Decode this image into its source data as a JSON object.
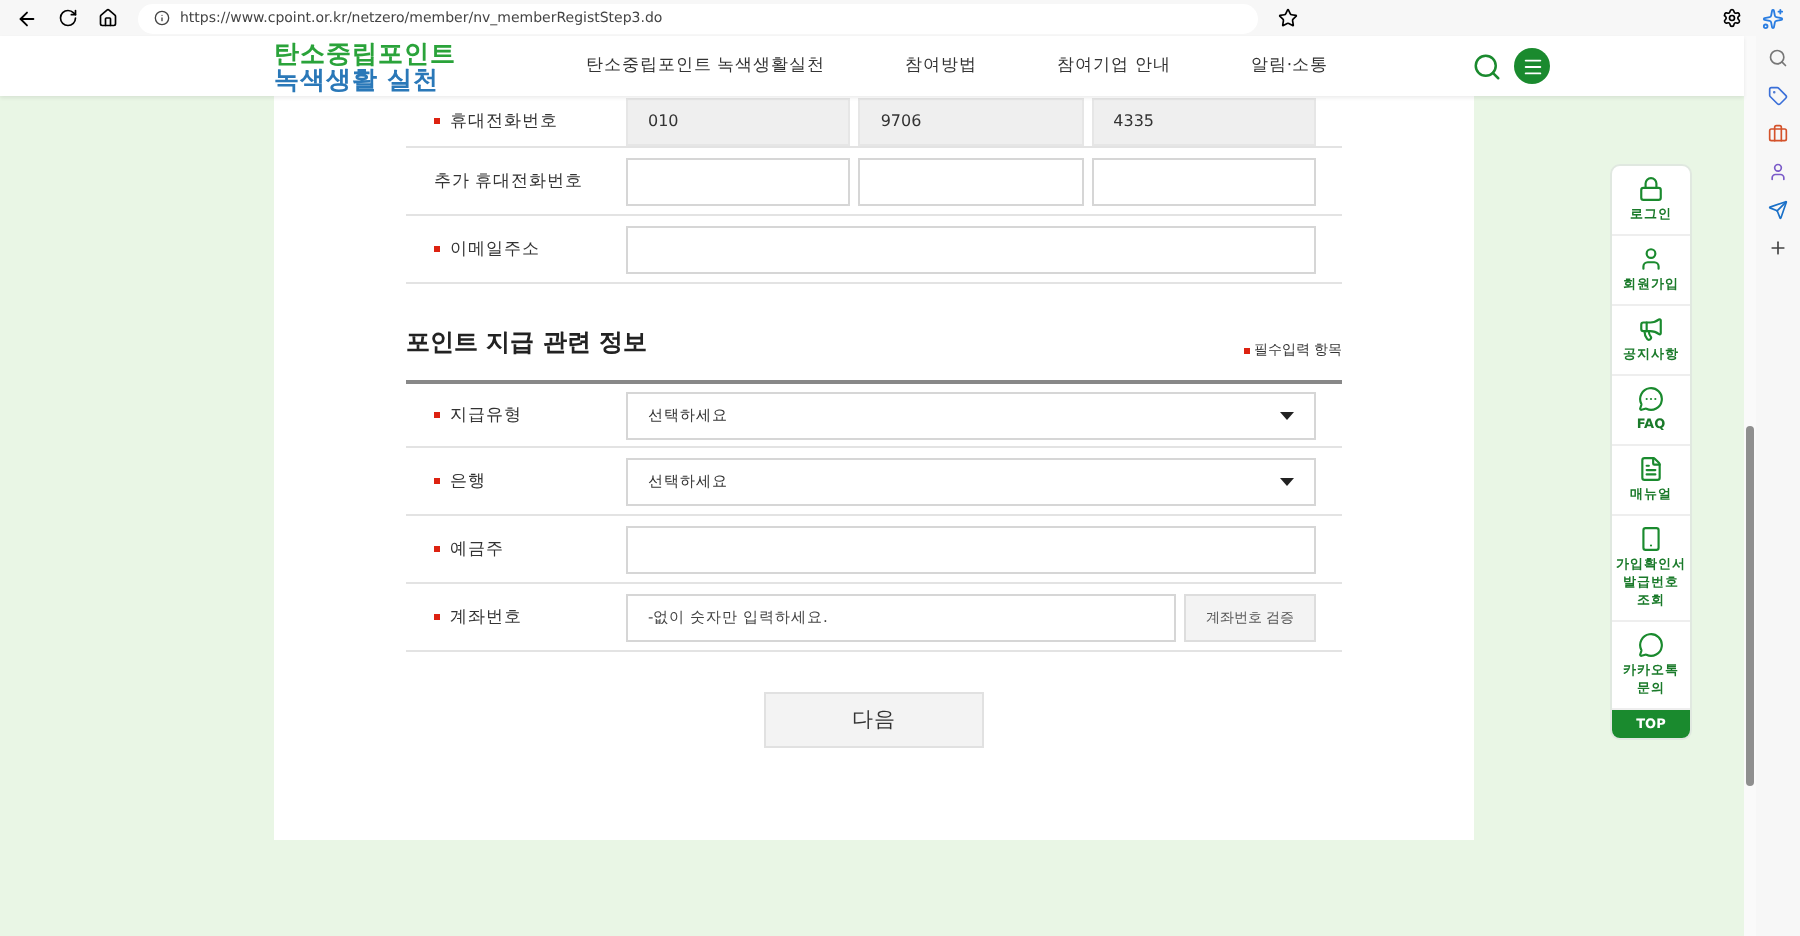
{
  "browser": {
    "url": "https://www.cpoint.or.kr/netzero/member/nv_memberRegistStep3.do"
  },
  "header": {
    "logo": [
      "탄소중립포인트",
      "녹색생활 실천"
    ],
    "nav": [
      {
        "label": "탄소중립포인트 녹색생활실천"
      },
      {
        "label": "참여방법"
      },
      {
        "label": "참여기업 안내"
      },
      {
        "label": "알림·소통"
      }
    ]
  },
  "contact_rows": [
    {
      "label": "휴대전화번호",
      "required": true,
      "kind": "phone",
      "fields": [
        {
          "value": "010",
          "disabled": true
        },
        {
          "value": "9706",
          "disabled": true
        },
        {
          "value": "4335",
          "disabled": true
        }
      ]
    },
    {
      "label": "추가 휴대전화번호",
      "required": false,
      "kind": "phone",
      "fields": [
        {
          "disabled": false
        },
        {
          "disabled": false
        },
        {
          "disabled": false
        }
      ]
    },
    {
      "label": "이메일주소",
      "required": true,
      "kind": "input"
    }
  ],
  "section": {
    "title": "포인트 지급 관련 정보",
    "required_note": "필수입력 항목"
  },
  "payment_rows": [
    {
      "label": "지급유형",
      "required": true,
      "kind": "select",
      "value": "선택하세요"
    },
    {
      "label": "은행",
      "required": true,
      "kind": "select",
      "value": "선택하세요"
    },
    {
      "label": "예금주",
      "required": true,
      "kind": "input"
    },
    {
      "label": "계좌번호",
      "required": true,
      "kind": "input-button",
      "placeholder": "-없이 숫자만 입력하세요.",
      "button": "계좌번호 검증"
    }
  ],
  "next_button": "다음",
  "quick_menu": [
    {
      "label": "로그인"
    },
    {
      "label": "회원가입"
    },
    {
      "label": "공지사항"
    },
    {
      "label": "FAQ"
    },
    {
      "label": "매뉴얼"
    },
    {
      "label": "가입확인서 발급번호 조회"
    },
    {
      "label": "카카오톡 문의"
    }
  ],
  "top_button": "TOP"
}
